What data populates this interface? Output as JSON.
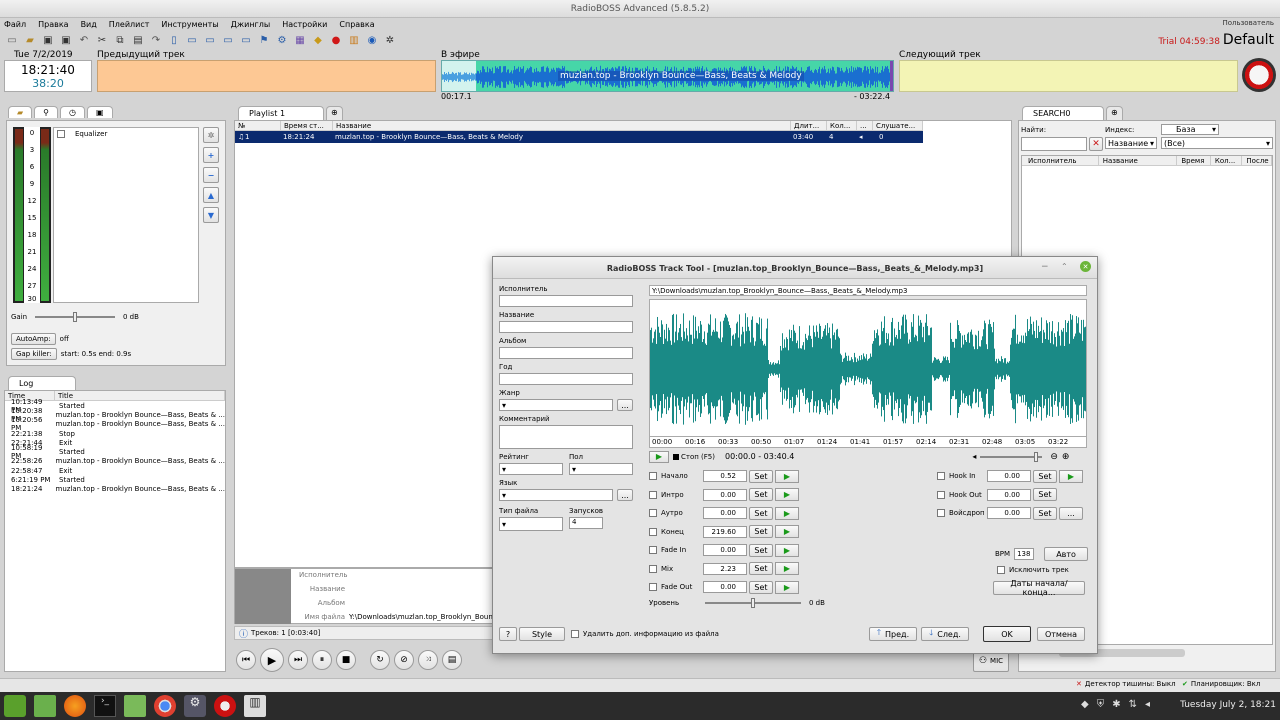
{
  "app": {
    "title": "RadioBOSS Advanced (5.8.5.2)",
    "user_label": "Пользователь",
    "trial": "Trial 04:59:38",
    "profile": "Default"
  },
  "menu": [
    "Файл",
    "Правка",
    "Вид",
    "Плейлист",
    "Инструменты",
    "Джинглы",
    "Настройки",
    "Справка"
  ],
  "clock": {
    "date": "Tue 7/2/2019",
    "time": "18:21:40",
    "remaining": "38:20"
  },
  "deck": {
    "prev_label": "Предыдущий трек",
    "onair_label": "В эфире",
    "next_label": "Следующий трек",
    "onair_track": "muzlan.top - Brooklyn Bounce—Bass, Beats & Melody",
    "elapsed": "00:17.1",
    "remain": "- 03:22.4"
  },
  "left": {
    "vu_scale": [
      "0",
      "3",
      "6",
      "9",
      "12",
      "15",
      "18",
      "21",
      "24",
      "27",
      "30"
    ],
    "equalizer": "Equalizer",
    "gain_label": "Gain",
    "gain_value": "0 dB",
    "autoamp_btn": "AutoAmp:",
    "autoamp_val": "off",
    "gapkiller_btn": "Gap killer:",
    "gapkiller_val": "start: 0.5s end: 0.9s"
  },
  "log": {
    "tab": "Log",
    "col_time": "Time",
    "col_title": "Title",
    "rows": [
      {
        "t": "10:13:49 PM",
        "v": "Started"
      },
      {
        "t": "10:20:38 PM",
        "v": "muzlan.top - Brooklyn Bounce—Bass, Beats & ..."
      },
      {
        "t": "10:20:56 PM",
        "v": "muzlan.top - Brooklyn Bounce—Bass, Beats & ..."
      },
      {
        "t": "22:21:38",
        "v": "Stop"
      },
      {
        "t": "22:21:44",
        "v": "Exit"
      },
      {
        "t": "10:58:19 PM",
        "v": "Started"
      },
      {
        "t": "22:58:26",
        "v": "muzlan.top - Brooklyn Bounce—Bass, Beats & ..."
      },
      {
        "t": "22:58:47",
        "v": "Exit"
      },
      {
        "t": "6:21:19 PM",
        "v": "Started"
      },
      {
        "t": "18:21:24",
        "v": "muzlan.top - Brooklyn Bounce—Bass, Beats & ..."
      }
    ]
  },
  "playlist": {
    "tab": "Playlist 1",
    "cols": [
      "№",
      "Время ст...",
      "Название",
      "Длит...",
      "Кол...",
      "...",
      "Слушате..."
    ],
    "row": {
      "num": "1",
      "start": "18:21:24",
      "name": "muzlan.top - Brooklyn Bounce—Bass, Beats & Melody",
      "dur": "03:40",
      "count": "4",
      "listeners": "0"
    },
    "info_labels": [
      "Исполнитель",
      "Название",
      "Альбом",
      "Имя файла"
    ],
    "info_file": "Y:\\Downloads\\muzlan.top_Brooklyn_Bounce—",
    "status": "Треков: 1 [0:03:40]"
  },
  "search": {
    "tab": "SEARCH0",
    "find_label": "Найти:",
    "index_label": "Индекс:",
    "index_value": "Название",
    "db_value": "База",
    "all_value": "(Все)",
    "cols": [
      "Исполнитель",
      "Название",
      "Время",
      "Кол...",
      "После"
    ]
  },
  "dialog": {
    "title": "RadioBOSS Track Tool - [muzlan.top_Brooklyn_Bounce—Bass,_Beats_&_Melody.mp3]",
    "path": "Y:\\Downloads\\muzlan.top_Brooklyn_Bounce—Bass,_Beats_&_Melody.mp3",
    "fields": {
      "artist": "Исполнитель",
      "title": "Название",
      "album": "Альбом",
      "year": "Год",
      "genre": "Жанр",
      "comment": "Комментарий",
      "rating": "Рейтинг",
      "gender": "Пол",
      "language": "Язык",
      "filetype": "Тип файла",
      "plays": "Запусков",
      "plays_value": "4"
    },
    "timeline": [
      "00:00",
      "00:16",
      "00:33",
      "00:50",
      "01:07",
      "01:24",
      "01:41",
      "01:57",
      "02:14",
      "02:31",
      "02:48",
      "03:05",
      "03:22"
    ],
    "stop_btn": "Стоп (F5)",
    "position": "00:00.0 - 03:40.4",
    "cues": [
      {
        "label": "Начало",
        "value": "0.52"
      },
      {
        "label": "Интро",
        "value": "0.00"
      },
      {
        "label": "Аутро",
        "value": "0.00"
      },
      {
        "label": "Конец",
        "value": "219.60"
      },
      {
        "label": "Fade In",
        "value": "0.00"
      },
      {
        "label": "Mix",
        "value": "2.23"
      },
      {
        "label": "Fade Out",
        "value": "0.00"
      }
    ],
    "hooks": [
      {
        "label": "Hook In",
        "value": "0.00"
      },
      {
        "label": "Hook Out",
        "value": "0.00"
      },
      {
        "label": "Войсдроп",
        "value": "0.00"
      }
    ],
    "set_label": "Set",
    "level_label": "Уровень",
    "level_value": "0 dB",
    "bpm_label": "BPM",
    "bpm_value": "138",
    "auto_btn": "Авто",
    "exclude": "Исключить трек",
    "dates_btn": "Даты начала/конца...",
    "help_btn": "?",
    "style_btn": "Style",
    "remove_info": "Удалить доп. информацию из файла",
    "prev_btn": "Пред.",
    "next_btn": "След.",
    "ok_btn": "OK",
    "cancel_btn": "Отмена"
  },
  "statusbar": {
    "silence": "Детектор тишины: Выкл",
    "scheduler": "Планировщик: Вкл",
    "mic": "MIC"
  },
  "taskbar": {
    "clock": "Tuesday July  2, 18:21"
  },
  "colors": {
    "onair": "#8fe6e0",
    "prev": "#fdc894",
    "next": "#f3f4b5",
    "wave": "#1a8a86",
    "selected": "#0b2a6e"
  }
}
